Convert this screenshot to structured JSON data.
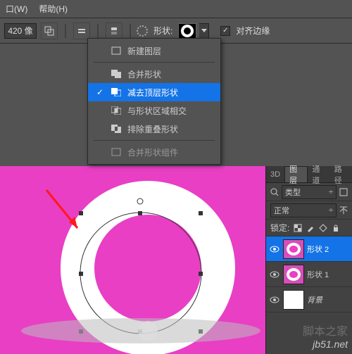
{
  "menu": {
    "window": "口(W)",
    "help": "帮助(H)"
  },
  "toolbar": {
    "size": "420 像",
    "shape_label": "形状:",
    "align_label": "对齐边缘"
  },
  "dropdown": {
    "items": [
      {
        "label": "新建图层",
        "checked": false
      },
      {
        "label": "合并形状",
        "checked": false
      },
      {
        "label": "减去顶层形状",
        "checked": true
      },
      {
        "label": "与形状区域相交",
        "checked": false
      },
      {
        "label": "排除重叠形状",
        "checked": false
      },
      {
        "label": "合并形状组件",
        "checked": false
      }
    ]
  },
  "panels": {
    "tabs": {
      "t3d": "3D",
      "layers": "图层",
      "channels": "通道",
      "paths": "路径"
    },
    "kind_label": "类型",
    "blend_mode": "正常",
    "opacity_suffix": "不",
    "lock_label": "锁定:",
    "layers": [
      {
        "name": "形状 2"
      },
      {
        "name": "形状 1"
      },
      {
        "name": "背景"
      }
    ]
  },
  "watermark": {
    "site": "jb51.net",
    "brand": "脚本之家"
  }
}
